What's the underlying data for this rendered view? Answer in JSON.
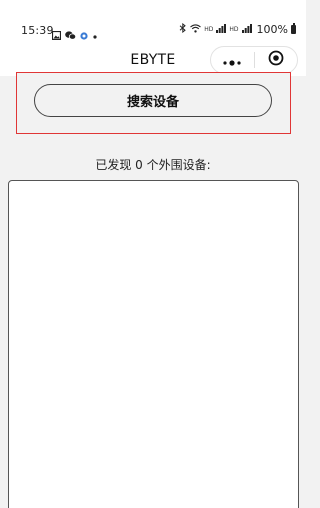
{
  "status_bar": {
    "time": "15:39",
    "left_icons": [
      "gallery-icon",
      "wechat-icon",
      "app-icon",
      "dot-icon"
    ],
    "right_icons": [
      "bluetooth-icon",
      "wifi-icon",
      "signal-icon",
      "signal-icon",
      "battery-icon"
    ],
    "network_label_1": "HD",
    "network_label_2": "HD",
    "battery_percent": "100%"
  },
  "nav_bar": {
    "title": "EBYTE",
    "more_icon": "more-dots-icon",
    "close_icon": "target-close-icon"
  },
  "search": {
    "button_label": "搜索设备",
    "highlight_color": "#e03636"
  },
  "devices": {
    "found_label": "已发现 0 个外围设备:",
    "items": []
  }
}
